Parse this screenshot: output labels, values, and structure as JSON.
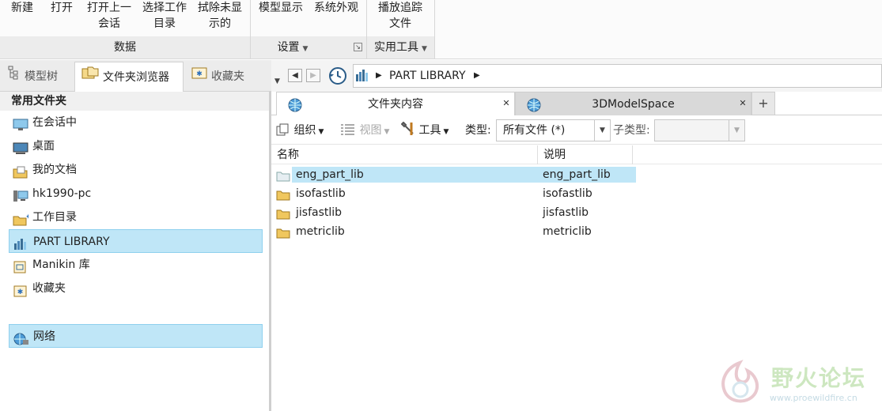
{
  "ribbon": {
    "buttons": [
      {
        "label": "新建"
      },
      {
        "label": "打开"
      },
      {
        "label": "打开上一\n会话"
      },
      {
        "label": "选择工作\n目录"
      },
      {
        "label": "拭除未显\n示的"
      },
      {
        "label": "模型显示"
      },
      {
        "label": "系统外观"
      },
      {
        "label": "播放追踪\n文件"
      }
    ],
    "groups": {
      "data": "数据",
      "settings": "设置",
      "utilities": "实用工具"
    }
  },
  "left_tabs": [
    "模型树",
    "文件夹浏览器",
    "收藏夹"
  ],
  "common_folders": {
    "title": "常用文件夹",
    "items": [
      {
        "label": "在会话中",
        "icon": "monitor-icon"
      },
      {
        "label": "桌面",
        "icon": "desktop-icon"
      },
      {
        "label": "我的文档",
        "icon": "documents-icon"
      },
      {
        "label": "hk1990-pc",
        "icon": "computer-icon"
      },
      {
        "label": "工作目录",
        "icon": "working-dir-icon"
      },
      {
        "label": "PART LIBRARY",
        "icon": "library-icon",
        "selected": true
      },
      {
        "label": "Manikin 库",
        "icon": "manikin-icon"
      },
      {
        "label": "收藏夹",
        "icon": "favorites-icon"
      },
      {
        "label": "网络",
        "icon": "network-icon",
        "selected": true
      }
    ]
  },
  "address": {
    "path": [
      "PART LIBRARY"
    ]
  },
  "content_tabs": [
    {
      "label": "文件夹内容",
      "active": true
    },
    {
      "label": "3DModelSpace",
      "active": false
    }
  ],
  "toolbar": {
    "organize": "组织",
    "views": "视图",
    "tools": "工具",
    "type_label": "类型:",
    "type_value": "所有文件 (*)",
    "subtype_label": "子类型:",
    "subtype_value": ""
  },
  "columns": [
    "名称",
    "说明"
  ],
  "files": [
    {
      "name": "eng_part_lib",
      "desc": "eng_part_lib",
      "selected": true
    },
    {
      "name": "isofastlib",
      "desc": "isofastlib"
    },
    {
      "name": "jisfastlib",
      "desc": "jisfastlib"
    },
    {
      "name": "metriclib",
      "desc": "metriclib"
    }
  ],
  "watermark": {
    "title": "野火论坛",
    "url": "www.proewildfire.cn"
  },
  "colors": {
    "selection": "#bfe6f7",
    "selection_border": "#8fd0ee",
    "folder": "#f0c75e"
  }
}
